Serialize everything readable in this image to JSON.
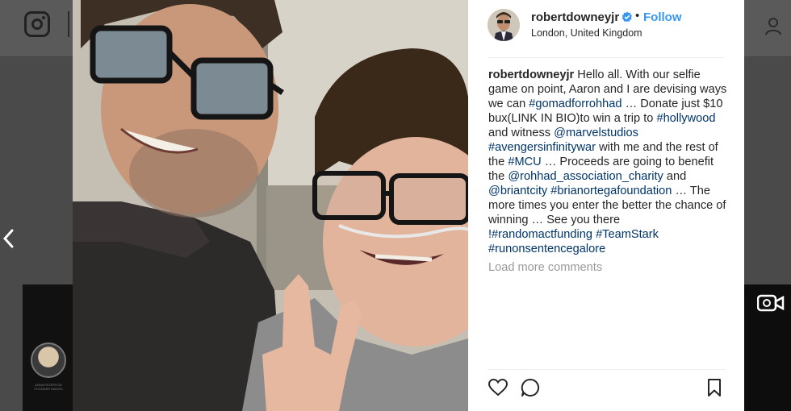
{
  "post": {
    "username": "robertdowneyjr",
    "follow_label": "Follow",
    "dot": "•",
    "location": "London, United Kingdom",
    "caption": {
      "username": "robertdowneyjr",
      "t1": " Hello all. With our selfie game on point, Aaron and I are devising ways we can ",
      "tag1": "#gomadforrohhad",
      "t2": " … Donate just $10 bux(LINK IN BIO)to win a trip to ",
      "tag2": "#hollywood",
      "t3": " and witness ",
      "mention1": "@marvelstudios",
      "t4": " ",
      "tag3": "#avengersinfinitywar",
      "t5": " with me and the rest of the ",
      "tag4": "#MCU",
      "t6": " … Proceeds are going to benefit the ",
      "mention2": "@rohhad_association_charity",
      "t7": " and ",
      "mention3": "@briantcity",
      "t8": " ",
      "tag5": "#brianortegafoundation",
      "t9": " … The more times you enter the better the chance of winning … See you there ",
      "tag6": "!#randomactfunding",
      "t10": " ",
      "tag7": "#TeamStark",
      "t11": " ",
      "tag8": "#runonsentencegalore"
    },
    "load_more": "Load more comments"
  },
  "background": {
    "thumb_caption": "ANNA PATERSON FOUNDER AWARD"
  },
  "colors": {
    "link": "#003569",
    "follow": "#3897f0",
    "text": "#262626",
    "muted": "#999999"
  },
  "icons": [
    "instagram-logo-icon",
    "chevron-left-icon",
    "verified-badge-icon",
    "heart-icon",
    "comment-icon",
    "bookmark-icon",
    "video-camera-icon",
    "user-icon"
  ]
}
